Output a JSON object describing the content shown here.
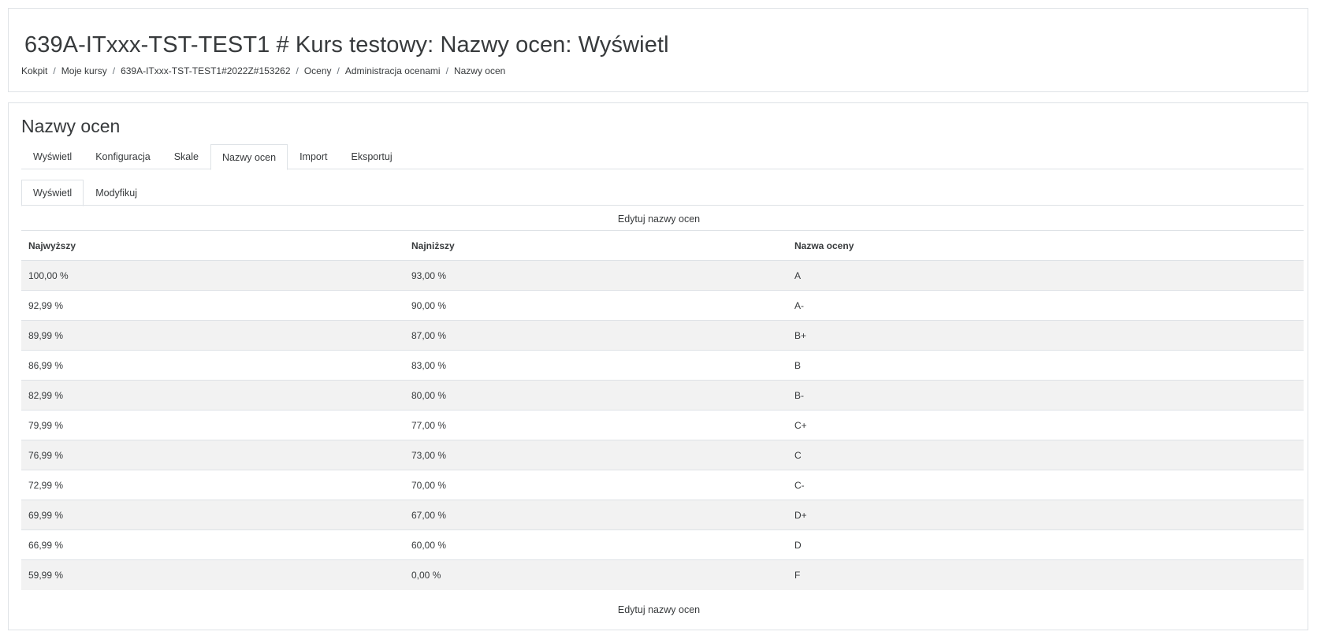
{
  "page_title": "639A-ITxxx-TST-TEST1 # Kurs testowy: Nazwy ocen: Wyświetl",
  "breadcrumb": [
    "Kokpit",
    "Moje kursy",
    "639A-ITxxx-TST-TEST1#2022Z#153262",
    "Oceny",
    "Administracja ocenami",
    "Nazwy ocen"
  ],
  "section_title": "Nazwy ocen",
  "tabs": [
    "Wyświetl",
    "Konfiguracja",
    "Skale",
    "Nazwy ocen",
    "Import",
    "Eksportuj"
  ],
  "active_tab": "Nazwy ocen",
  "subtabs": [
    "Wyświetl",
    "Modyfikuj"
  ],
  "active_subtab": "Wyświetl",
  "edit_link_label": "Edytuj nazwy ocen",
  "table": {
    "headers": [
      "Najwyższy",
      "Najniższy",
      "Nazwa oceny"
    ],
    "rows": [
      [
        "100,00 %",
        "93,00 %",
        "A"
      ],
      [
        "92,99 %",
        "90,00 %",
        "A-"
      ],
      [
        "89,99 %",
        "87,00 %",
        "B+"
      ],
      [
        "86,99 %",
        "83,00 %",
        "B"
      ],
      [
        "82,99 %",
        "80,00 %",
        "B-"
      ],
      [
        "79,99 %",
        "77,00 %",
        "C+"
      ],
      [
        "76,99 %",
        "73,00 %",
        "C"
      ],
      [
        "72,99 %",
        "70,00 %",
        "C-"
      ],
      [
        "69,99 %",
        "67,00 %",
        "D+"
      ],
      [
        "66,99 %",
        "60,00 %",
        "D"
      ],
      [
        "59,99 %",
        "0,00 %",
        "F"
      ]
    ]
  },
  "colors": {
    "text": "#373a3c",
    "border": "#dee2e6",
    "stripe": "#f2f2f2"
  }
}
